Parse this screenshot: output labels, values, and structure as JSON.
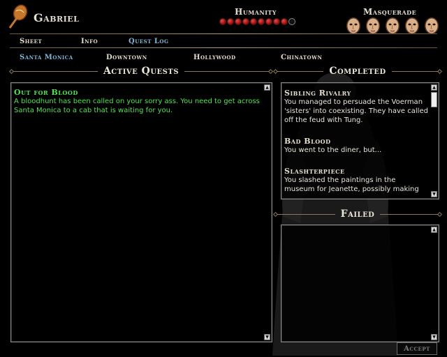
{
  "character": {
    "name": "Gabriel"
  },
  "humanity": {
    "label": "Humanity",
    "filled": 9,
    "total": 10
  },
  "masquerade": {
    "label": "Masquerade",
    "masks": 5
  },
  "menu_tabs": [
    {
      "label": "Sheet",
      "active": false
    },
    {
      "label": "Info",
      "active": false
    },
    {
      "label": "Quest Log",
      "active": true
    }
  ],
  "locations": [
    {
      "label": "Santa Monica",
      "active": true
    },
    {
      "label": "Downtown",
      "active": false
    },
    {
      "label": "Hollywood",
      "active": false
    },
    {
      "label": "Chinatown",
      "active": false
    }
  ],
  "active_quests": {
    "title": "Active Quests",
    "items": [
      {
        "title": "Out for Blood",
        "body": "A bloodhunt has been called on your sorry ass. You need to get across Santa Monica to a cab that is waiting for you."
      }
    ]
  },
  "completed": {
    "title": "Completed",
    "items": [
      {
        "title": "Sibling Rivalry",
        "body": "You managed to persuade the Voerman 'sisters' into coexisting.  They have called off the feud with Tung."
      },
      {
        "title": "Bad Blood",
        "body": "You went to the diner, but..."
      },
      {
        "title": "Slashterpiece",
        "body": "You slashed the paintings in the museum for Jeanette, possibly making"
      }
    ]
  },
  "failed": {
    "title": "Failed",
    "items": []
  },
  "accept_label": "Accept",
  "colors": {
    "active_tab": "#7fb8d8",
    "active_quest": "#4ee24e",
    "humanity_dot": "#c41a1a"
  }
}
